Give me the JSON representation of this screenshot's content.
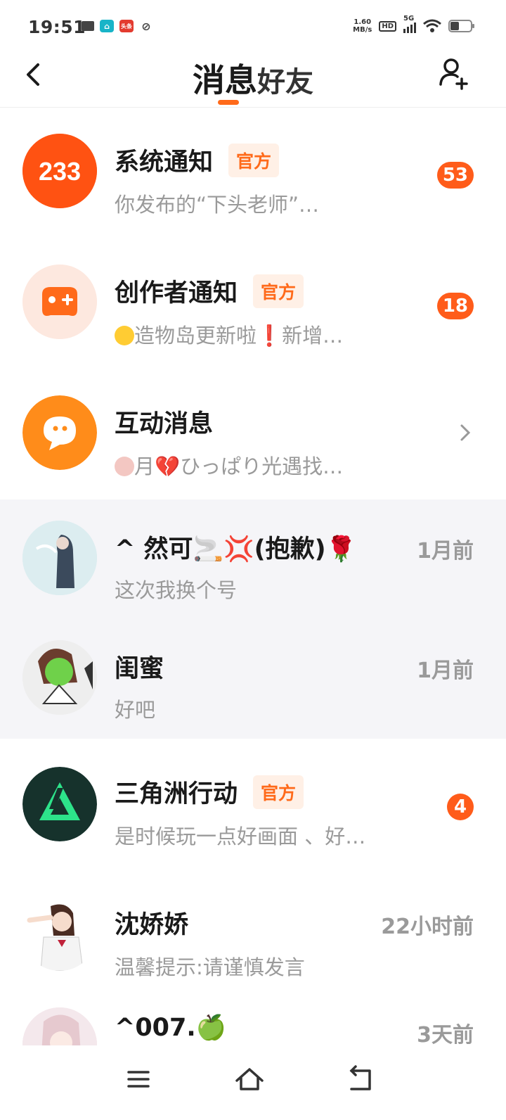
{
  "status_bar": {
    "time": "19:51",
    "net_speed_value": "1.60",
    "net_speed_unit": "MB/s",
    "hd": "HD",
    "network": "5G",
    "battery_percent": 35
  },
  "header": {
    "tabs": [
      {
        "label": "消息",
        "active": true
      },
      {
        "label": "好友",
        "active": false
      }
    ],
    "accent_color": "#ff6a1a"
  },
  "conversations": [
    {
      "name": "系统通知",
      "tag": "官方",
      "preview": "你发布的“下头老师”…",
      "badge": "53",
      "avatar_icon": "233-logo-icon"
    },
    {
      "name": "创作者通知",
      "tag": "官方",
      "preview": "造物岛更新啦❗新增…",
      "badge": "18",
      "avatar_icon": "gamepad-icon"
    },
    {
      "name": "互动消息",
      "preview": "月💔ひっぱり光遇找…",
      "avatar_icon": "chat-bubble-icon"
    },
    {
      "name": "^ 然可🚬💢(抱歉)🌹",
      "preview": "这次我换个号",
      "time": "1月前",
      "highlighted": true
    },
    {
      "name": "闺蜜",
      "preview": "好吧",
      "time": "1月前",
      "highlighted": true
    },
    {
      "name": "三角洲行动",
      "tag": "官方",
      "preview": "是时候玩一点好画面 、好…",
      "badge": "4",
      "avatar_icon": "delta-force-logo-icon"
    },
    {
      "name": "沈娇娇",
      "preview": "温馨提示:请谨慎发言",
      "time": "22小时前"
    },
    {
      "name": "^007.🍏",
      "preview": "",
      "time": "3天前"
    }
  ]
}
